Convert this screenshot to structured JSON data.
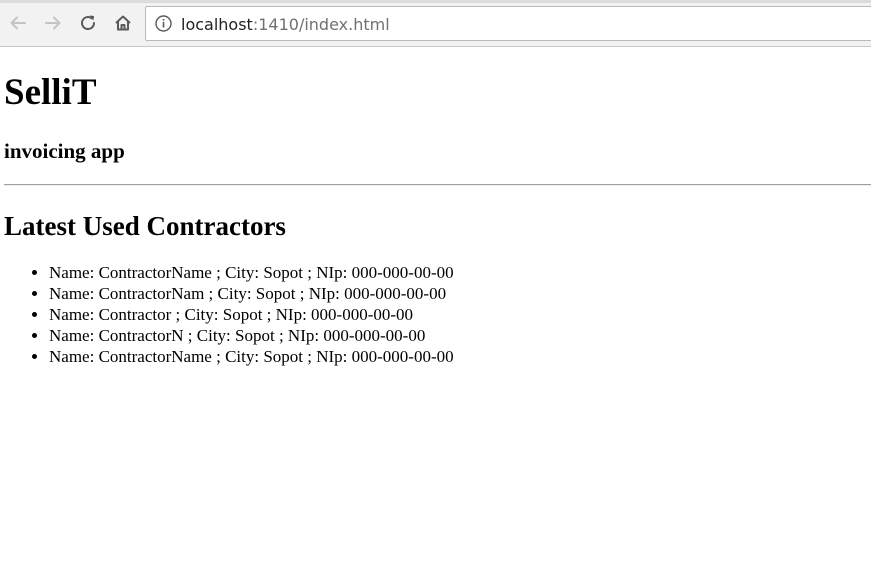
{
  "browser": {
    "url_host": "localhost",
    "url_rest": ":1410/index.html"
  },
  "page": {
    "title": "SelliT",
    "subtitle": "invoicing app",
    "section_heading": "Latest Used Contractors",
    "contractors": [
      "Name: ContractorName ; City: Sopot ; NIp: 000-000-00-00",
      "Name: ContractorNam ; City: Sopot ; NIp: 000-000-00-00",
      "Name: Contractor ; City: Sopot ; NIp: 000-000-00-00",
      "Name: ContractorN ; City: Sopot ; NIp: 000-000-00-00",
      "Name: ContractorName ; City: Sopot ; NIp: 000-000-00-00"
    ]
  },
  "icons": {
    "back": "back-arrow-icon",
    "forward": "forward-arrow-icon",
    "reload": "reload-icon",
    "home": "home-icon",
    "info": "info-icon"
  },
  "colors": {
    "toolbar_bg": "#f2f2f2",
    "url_host": "#222222",
    "url_path": "#707070",
    "hr": "#a0a0a0"
  }
}
